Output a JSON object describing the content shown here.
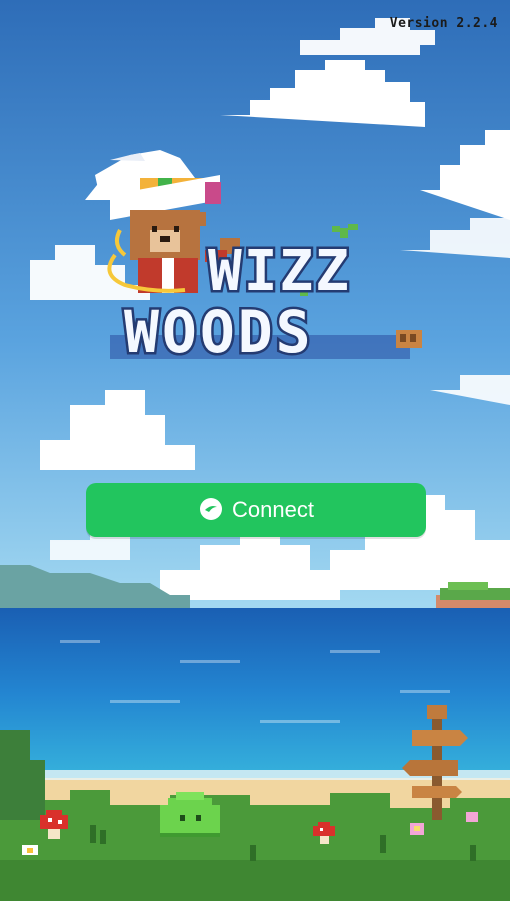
{
  "game": {
    "version_text": "Version 2.2.4",
    "logo_line1": "WIZZ",
    "logo_line2": "WOODS"
  },
  "connect_button": {
    "label": "Connect",
    "icon": "chat-bubble-icon",
    "color": "#22c55e"
  },
  "colors": {
    "sky_top": "#2f6fb8",
    "sky_bottom": "#8fd0ef",
    "sea": "#1f6fc4",
    "sand": "#f2d9a4",
    "grass": "#4c9a3c",
    "logo_fill": "#f4f8ff",
    "logo_outline": "#243b72",
    "logo_accent": "#5fb84a"
  }
}
